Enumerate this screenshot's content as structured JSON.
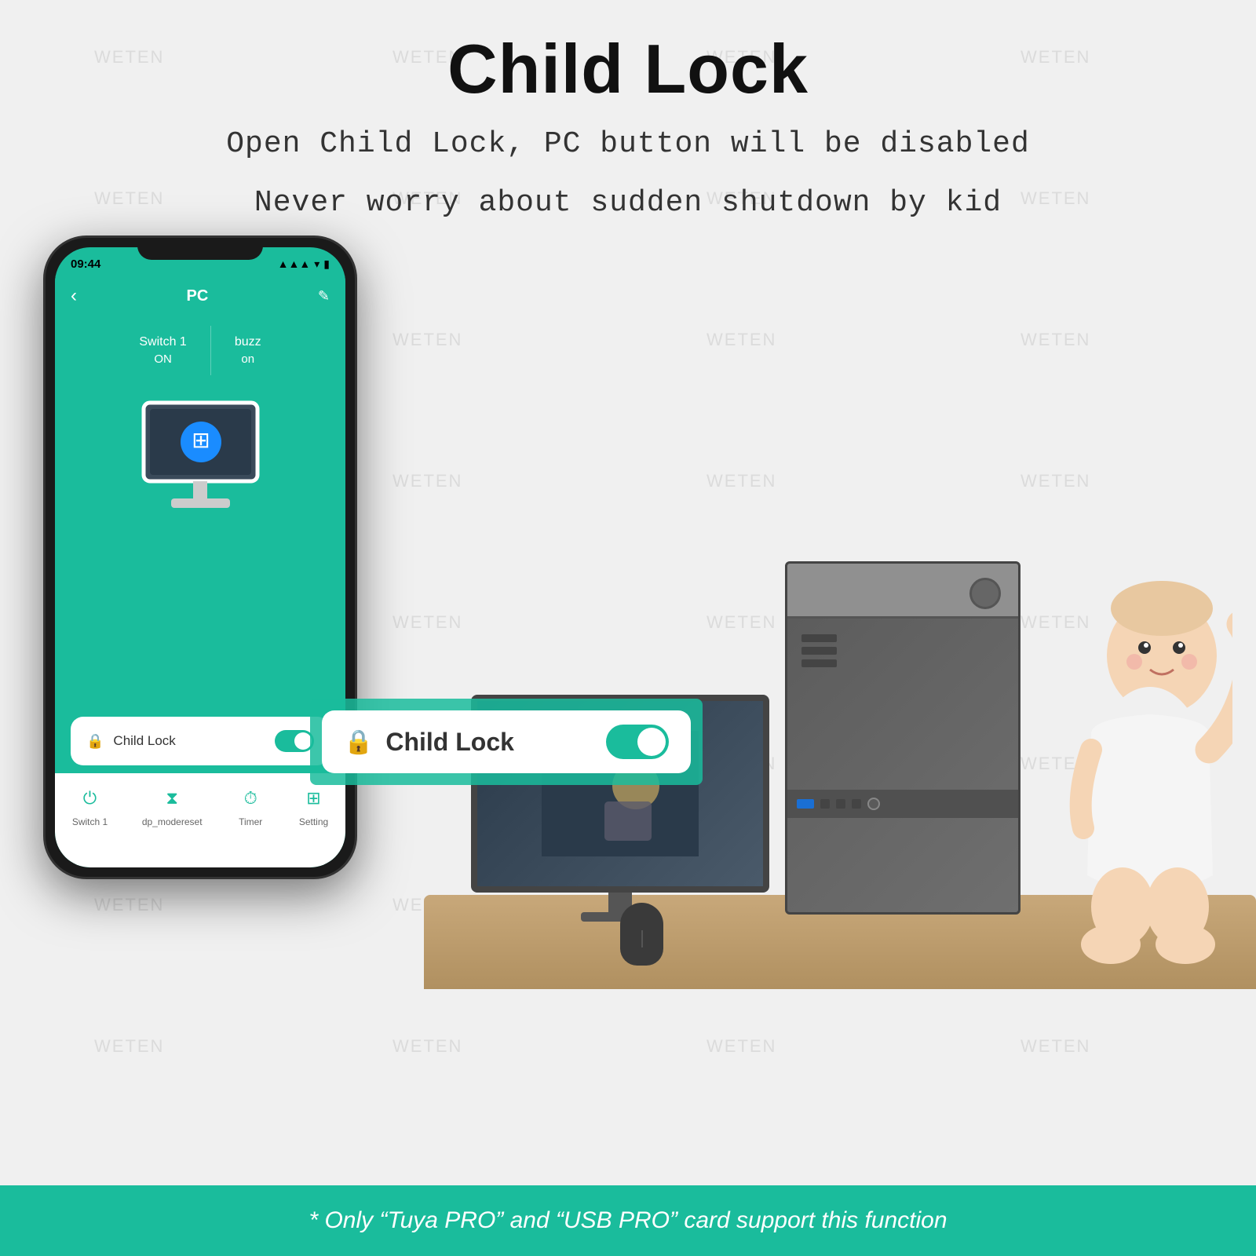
{
  "watermark": {
    "text": "WETEN"
  },
  "header": {
    "title": "Child Lock",
    "subtitle_line1": "Open Child Lock, PC button will be disabled",
    "subtitle_line2": "Never worry about sudden shutdown by kid"
  },
  "phone": {
    "status": {
      "time": "09:44",
      "signal": "▲",
      "wifi": "WiFi",
      "battery": "🔋"
    },
    "nav": {
      "back": "‹",
      "title": "PC",
      "edit": "✎"
    },
    "switches": [
      {
        "name": "Switch 1",
        "state": "ON"
      },
      {
        "name": "buzz",
        "state": "on"
      }
    ],
    "child_lock_label": "Child Lock",
    "bottom_nav": [
      {
        "icon": "⏻",
        "label": "Switch 1"
      },
      {
        "icon": "⧗",
        "label": "dp_modereset"
      },
      {
        "icon": "⏱",
        "label": "Timer"
      },
      {
        "icon": "⊞",
        "label": "Setting"
      }
    ]
  },
  "child_lock_popup": {
    "label": "Child Lock"
  },
  "footer": {
    "text_before": "* Only “Tuya PRO” and “USB PRO” card support this function"
  }
}
